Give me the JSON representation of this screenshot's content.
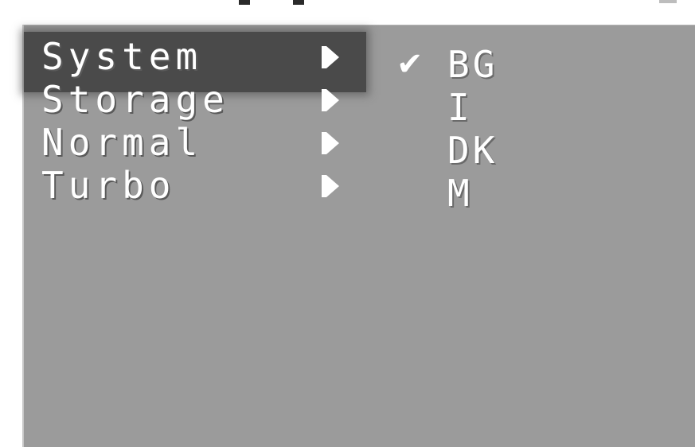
{
  "menu": {
    "items": [
      {
        "label": "System",
        "selected": true
      },
      {
        "label": "Storage",
        "selected": false
      },
      {
        "label": "Normal",
        "selected": false
      },
      {
        "label": "Turbo",
        "selected": false
      }
    ],
    "arrow_icon": "triangle-right-icon"
  },
  "options": {
    "check_icon": "checkmark-icon",
    "check_glyph": "✔",
    "items": [
      {
        "label": "BG",
        "checked": true
      },
      {
        "label": "I",
        "checked": false
      },
      {
        "label": "DK",
        "checked": false
      },
      {
        "label": "M",
        "checked": false
      }
    ]
  },
  "colors": {
    "panel_bg": "#9b9b9b",
    "highlight_bg": "#4a4a4a",
    "text": "#ffffff"
  }
}
